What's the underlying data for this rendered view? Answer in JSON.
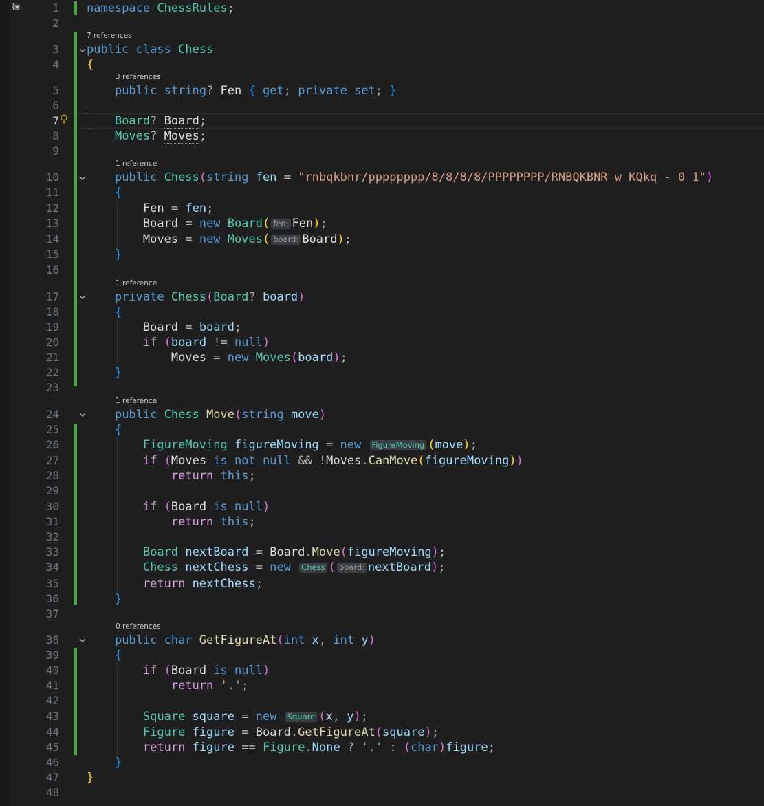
{
  "editor": {
    "file_namespace": "ChessRules",
    "current_line": 7,
    "codelens": {
      "l3": "7 references",
      "l5": "3 references",
      "l10": "1 reference",
      "l17": "1 reference",
      "l24": "1 reference",
      "l38": "0 references"
    },
    "hints": {
      "fen": "fen:",
      "board": "board:",
      "figure_moving": "FigureMoving",
      "chess": "Chess",
      "square": "Square"
    },
    "default_fen": "\"rnbqkbnr/pppppppp/8/8/8/8/PPPPPPPP/RNBQKBNR w KQkq - 0 1\"",
    "line_numbers": [
      "1",
      "2",
      "3",
      "4",
      "5",
      "6",
      "7",
      "8",
      "9",
      "10",
      "11",
      "12",
      "13",
      "14",
      "15",
      "16",
      "17",
      "18",
      "19",
      "20",
      "21",
      "22",
      "23",
      "24",
      "25",
      "26",
      "27",
      "28",
      "29",
      "30",
      "31",
      "32",
      "33",
      "34",
      "35",
      "36",
      "37",
      "38",
      "39",
      "40",
      "41",
      "42",
      "43",
      "44",
      "45",
      "46",
      "47",
      "48"
    ]
  }
}
